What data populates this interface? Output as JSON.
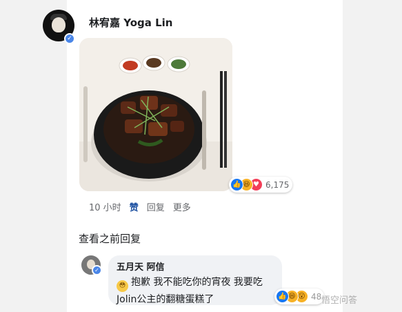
{
  "post": {
    "author_name": "林宥嘉 Yoga Lin",
    "reactions_count": "6,175",
    "actions": {
      "time": "10 小时",
      "like": "赞",
      "reply": "回复",
      "more": "更多"
    }
  },
  "view_previous_replies": "查看之前回复",
  "reply": {
    "author_name": "五月天 阿信",
    "text": "抱歉 我不能吃你的宵夜 我要吃Jolin公主的翻糖蛋糕了",
    "reactions_count": "48"
  },
  "watermark": "悟空问答",
  "icons": {
    "verified": "verified-badge-icon",
    "like": "like-reaction-icon",
    "haha": "haha-reaction-icon",
    "love": "love-reaction-icon",
    "wow": "wow-reaction-icon",
    "flushed": "flushed-face-emoji-icon"
  },
  "colors": {
    "facebook_blue": "#1877f2",
    "verified_blue": "#4a86e8",
    "liked_text": "#1b4fa0",
    "bubble_bg": "#f0f2f5"
  }
}
